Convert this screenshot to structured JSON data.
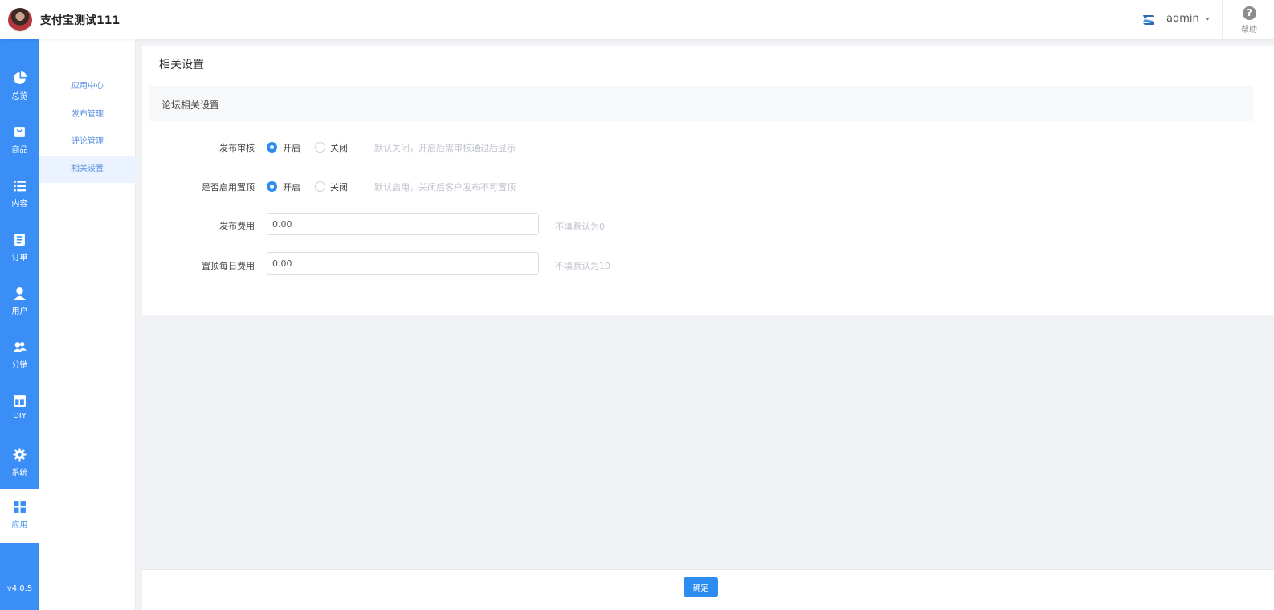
{
  "header": {
    "store_name": "支付宝测试111",
    "username": "admin",
    "help_label": "帮助"
  },
  "rail": {
    "items": [
      {
        "label": "总览",
        "icon": "pie-chart-icon"
      },
      {
        "label": "商品",
        "icon": "shopping-bag-icon"
      },
      {
        "label": "内容",
        "icon": "list-icon"
      },
      {
        "label": "订单",
        "icon": "document-icon"
      },
      {
        "label": "用户",
        "icon": "user-icon"
      },
      {
        "label": "分销",
        "icon": "users-icon"
      },
      {
        "label": "DIY",
        "icon": "layout-icon"
      },
      {
        "label": "系统",
        "icon": "gear-icon"
      },
      {
        "label": "应用",
        "icon": "apps-grid-icon"
      }
    ],
    "active": "应用",
    "version": "v4.0.5"
  },
  "subnav": {
    "items": [
      "应用中心",
      "发布管理",
      "评论管理",
      "相关设置"
    ],
    "active": "相关设置"
  },
  "main": {
    "title": "相关设置",
    "section_title": "论坛相关设置",
    "form": {
      "publish_review": {
        "label": "发布审核",
        "options": [
          "开启",
          "关闭"
        ],
        "selected": "开启",
        "hint": "默认关闭，开启后需审核通过后显示"
      },
      "enable_pin": {
        "label": "是否启用置顶",
        "options": [
          "开启",
          "关闭"
        ],
        "selected": "开启",
        "hint": "默认启用，关闭后客户发布不可置顶"
      },
      "publish_fee": {
        "label": "发布费用",
        "value": "0.00",
        "hint": "不填默认为0"
      },
      "pin_daily_fee": {
        "label": "置顶每日费用",
        "value": "0.00",
        "hint": "不填默认为10"
      }
    }
  },
  "footer": {
    "confirm_label": "确定"
  },
  "colors": {
    "primary": "#2d8cf0",
    "rail": "#3a8ef6"
  }
}
